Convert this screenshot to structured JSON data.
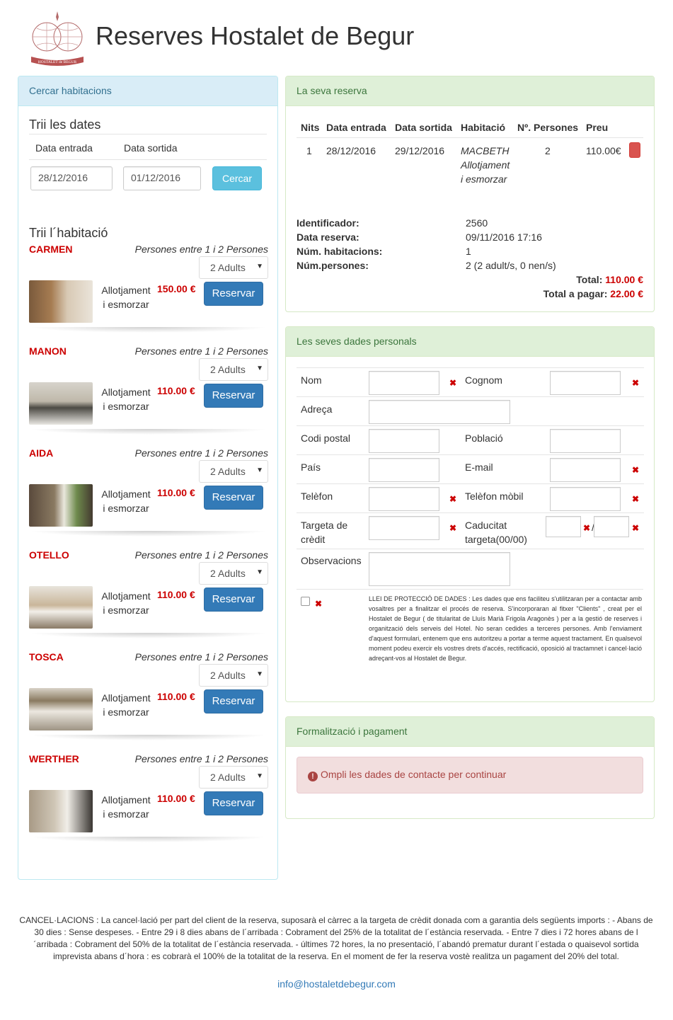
{
  "header": {
    "title": "Reserves Hostalet de Begur",
    "logo_text": "HOSTALET de BEGUR"
  },
  "search": {
    "panel_title": "Cercar habitacions",
    "dates_title": "Trii les dates",
    "checkin_label": "Data entrada",
    "checkout_label": "Data sortida",
    "checkin_value": "28/12/2016",
    "checkout_value": "01/12/2016",
    "search_button": "Cercar",
    "rooms_title": "Trii l´habitació"
  },
  "rooms": [
    {
      "name": "CARMEN",
      "capacity": "Persones entre 1 i 2 Persones",
      "adults": "2 Adults",
      "board_line1": "Allotjament",
      "board_line2": "i esmorzar",
      "price": "150.00 €",
      "button": "Reservar"
    },
    {
      "name": "MANON",
      "capacity": "Persones entre 1 i 2 Persones",
      "adults": "2 Adults",
      "board_line1": "Allotjament",
      "board_line2": "i esmorzar",
      "price": "110.00 €",
      "button": "Reservar"
    },
    {
      "name": "AIDA",
      "capacity": "Persones entre 1 i 2 Persones",
      "adults": "2 Adults",
      "board_line1": "Allotjament",
      "board_line2": "i esmorzar",
      "price": "110.00 €",
      "button": "Reservar"
    },
    {
      "name": "OTELLO",
      "capacity": "Persones entre 1 i 2 Persones",
      "adults": "2 Adults",
      "board_line1": "Allotjament",
      "board_line2": "i esmorzar",
      "price": "110.00 €",
      "button": "Reservar"
    },
    {
      "name": "TOSCA",
      "capacity": "Persones entre 1 i 2 Persones",
      "adults": "2 Adults",
      "board_line1": "Allotjament",
      "board_line2": "i esmorzar",
      "price": "110.00 €",
      "button": "Reservar"
    },
    {
      "name": "WERTHER",
      "capacity": "Persones entre 1 i 2 Persones",
      "adults": "2 Adults",
      "board_line1": "Allotjament",
      "board_line2": "i esmorzar",
      "price": "110.00 €",
      "button": "Reservar"
    }
  ],
  "reservation": {
    "panel_title": "La seva reserva",
    "headers": [
      "Nits",
      "Data entrada",
      "Data sortida",
      "Habitació",
      "Nº. Persones",
      "Preu"
    ],
    "row": {
      "nits": "1",
      "entrada": "28/12/2016",
      "sortida": "29/12/2016",
      "room_line1": "MACBETH",
      "room_line2": "Allotjament",
      "room_line3": "i esmorzar",
      "persones": "2",
      "preu": "110.00€"
    },
    "info": [
      {
        "label": "Identificador:",
        "value": "2560"
      },
      {
        "label": "Data reserva:",
        "value": "09/11/2016 17:16"
      },
      {
        "label": "Núm. habitacions:",
        "value": "1"
      },
      {
        "label": "Núm.persones:",
        "value": "2 (2 adult/s, 0 nen/s)"
      }
    ],
    "total_label": "Total:",
    "total_value": "110.00 €",
    "topay_label": "Total a pagar:",
    "topay_value": "22.00 €"
  },
  "personal": {
    "panel_title": "Les seves dades personals",
    "nom": "Nom",
    "cognom": "Cognom",
    "adreca": "Adreça",
    "codi_postal": "Codi postal",
    "poblacio": "Població",
    "pais": "País",
    "email": "E-mail",
    "telefon": "Telèfon",
    "mobil": "Telèfon mòbil",
    "targeta_1": "Targeta de",
    "targeta_2": "crèdit",
    "caducitat_1": "Caducitat",
    "caducitat_2": "targeta(00/00)",
    "slash": "/",
    "observacions": "Observacions",
    "required_mark": "✖",
    "legal": "LLEI DE PROTECCIÓ DE DADES : Les dades que ens faciliteu s'utilitzaran per a contactar amb vosaltres per a finalitzar el procés de reserva. S'incorporaran al fitxer \"Clients\" , creat per el Hostalet de Begur ( de titularitat de Lluís Marià Frigola Aragonès ) per a la gestió de reserves i organització dels serveis del Hotel. No seran cedides a terceres persones. Amb l'enviament d'aquest formulari, entenem que ens autoritzeu a portar a terme aquest tractament. En qualsevol moment podeu exercir els vostres drets d'accés, rectificació, oposició al tractamnet i cancel·lació adreçant-vos al Hostalet de Begur."
  },
  "payment": {
    "panel_title": "Formalització i pagament",
    "alert": "Ompli les dades de contacte per continuar"
  },
  "footer": {
    "cancel_text": "CANCEL·LACIONS : La cancel·lació per part del client de la reserva, suposarà el càrrec a la targeta de crèdit donada com a garantia dels següents imports : - Abans de 30 dies : Sense despeses. - Entre 29 i 8 dies abans de l´arribada : Cobrament del 25% de la totalitat de l´estància reservada. - Entre 7 dies i 72 hores abans de l´arribada : Cobrament del 50% de la totalitat de l´estància reservada. - últimes 72 hores, la no presentació, l´abandó prematur durant l´estada o quaisevol sortida imprevista abans d´hora : es cobrarà el 100% de la totalitat de la reserva. En el moment de fer la reserva vostè realitza un pagament del 20% del total.",
    "email": "info@hostaletdebegur.com"
  },
  "colors": {
    "accent_red": "#cc0000",
    "primary": "#337ab7",
    "info": "#5bc0de"
  }
}
